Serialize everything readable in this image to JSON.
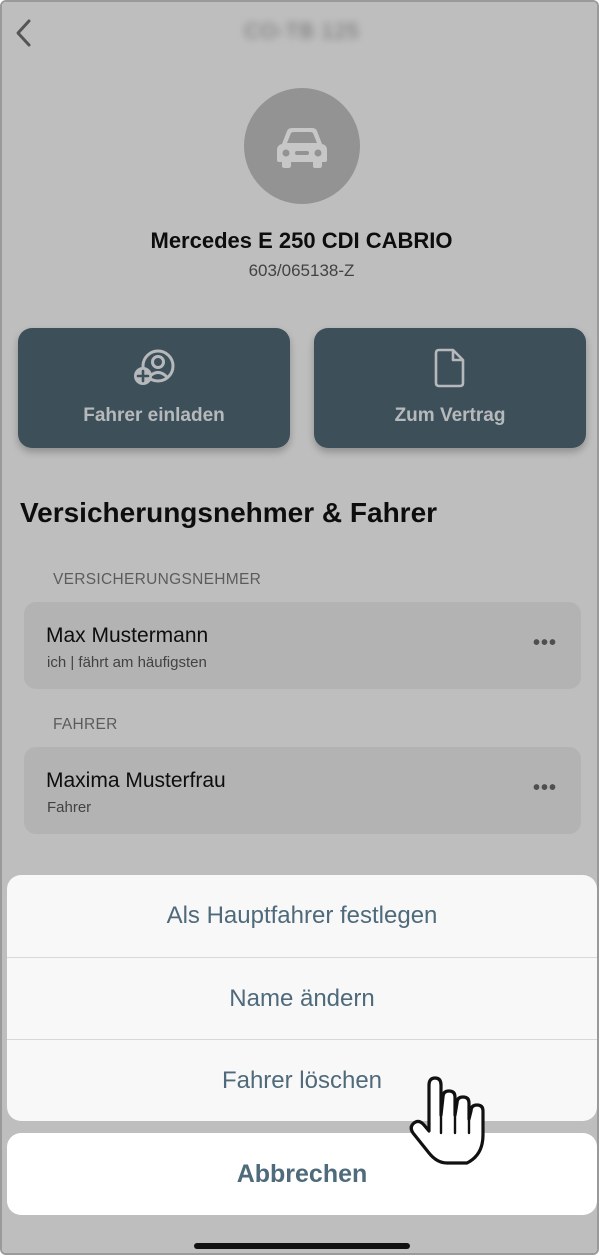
{
  "nav": {
    "plate": "CO-TB 125"
  },
  "vehicle": {
    "icon": "car-icon",
    "title": "Mercedes E 250 CDI CABRIO",
    "number": "603/065138-Z"
  },
  "actions": [
    {
      "label": "Fahrer einladen",
      "icon": "add-person-icon"
    },
    {
      "label": "Zum Vertrag",
      "icon": "document-icon"
    }
  ],
  "section_title": "Versicherungsnehmer & Fahrer",
  "policyholder": {
    "group_label": "VERSICHERUNGSNEHMER",
    "name": "Max Mustermann",
    "role": "ich | fährt am häufigsten"
  },
  "driver": {
    "group_label": "FAHRER",
    "name": "Maxima Musterfrau",
    "role": "Fahrer"
  },
  "more_label": "•••",
  "sheet": {
    "items": [
      "Als Hauptfahrer festlegen",
      "Name ändern",
      "Fahrer löschen"
    ],
    "cancel": "Abbrechen"
  },
  "colors": {
    "accent": "#4f6672",
    "sheet_text": "#4f6a7a"
  }
}
